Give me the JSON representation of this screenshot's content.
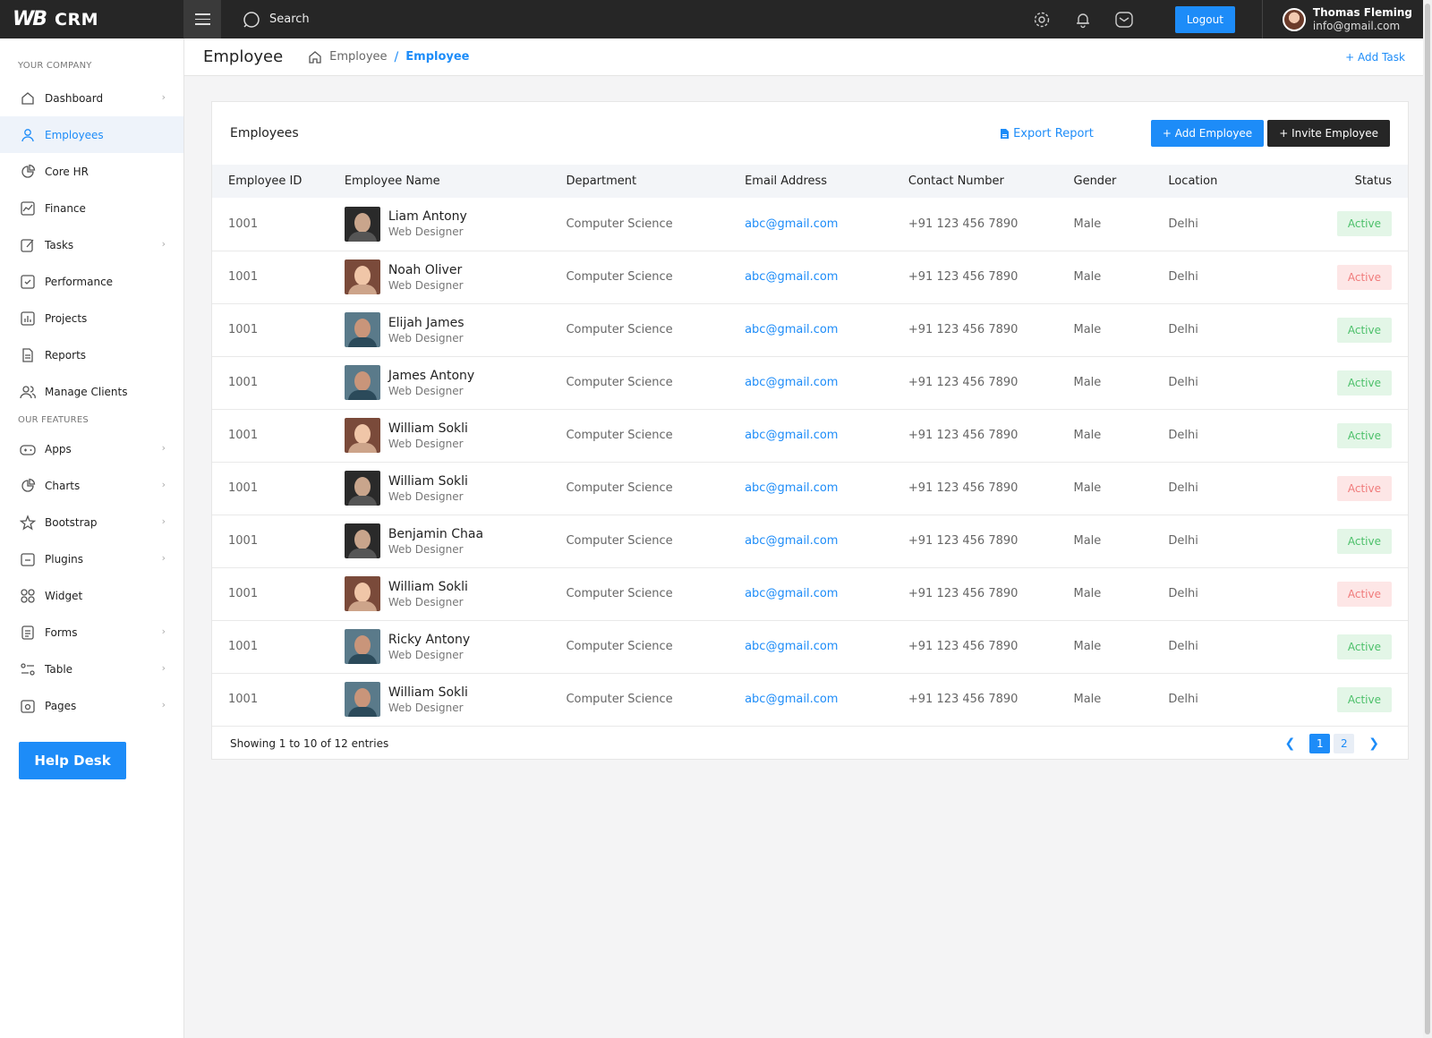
{
  "brand": {
    "logo": "WB",
    "name": "CRM"
  },
  "topbar": {
    "search_label": "Search",
    "logout_label": "Logout",
    "user_name": "Thomas Fleming",
    "user_email": "info@gmail.com"
  },
  "sidebar": {
    "section_company": "YOUR COMPANY",
    "section_features": "OUR FEATURES",
    "company_items": [
      {
        "label": "Dashboard",
        "icon": "home-icon",
        "chevron": true
      },
      {
        "label": "Employees",
        "icon": "user-icon",
        "active": true
      },
      {
        "label": "Core HR",
        "icon": "pie-icon"
      },
      {
        "label": "Finance",
        "icon": "chart-line-icon"
      },
      {
        "label": "Tasks",
        "icon": "edit-icon",
        "chevron": true
      },
      {
        "label": "Performance",
        "icon": "check-square-icon"
      },
      {
        "label": "Projects",
        "icon": "bar-chart-icon"
      },
      {
        "label": "Reports",
        "icon": "document-icon"
      },
      {
        "label": "Manage Clients",
        "icon": "users-icon"
      }
    ],
    "feature_items": [
      {
        "label": "Apps",
        "icon": "gamepad-icon",
        "chevron": true
      },
      {
        "label": "Charts",
        "icon": "pie-icon",
        "chevron": true
      },
      {
        "label": "Bootstrap",
        "icon": "star-icon",
        "chevron": true
      },
      {
        "label": "Plugins",
        "icon": "plugin-icon",
        "chevron": true
      },
      {
        "label": "Widget",
        "icon": "grid-icon"
      },
      {
        "label": "Forms",
        "icon": "form-icon",
        "chevron": true
      },
      {
        "label": "Table",
        "icon": "table-icon",
        "chevron": true
      },
      {
        "label": "Pages",
        "icon": "pages-icon",
        "chevron": true
      }
    ],
    "help_label": "Help Desk"
  },
  "page": {
    "title": "Employee",
    "crumb_1": "Employee",
    "crumb_sep": "/",
    "crumb_2": "Employee",
    "add_task": "+ Add Task"
  },
  "card": {
    "title": "Employees",
    "export_label": "Export Report",
    "add_label": "+ Add Employee",
    "invite_label": "+ Invite Employee",
    "columns": [
      "Employee ID",
      "Employee Name",
      "Department",
      "Email Address",
      "Contact Number",
      "Gender",
      "Location",
      "Status"
    ],
    "rows": [
      {
        "id": "1001",
        "name": "Liam Antony",
        "role": "Web Designer",
        "dept": "Computer Science",
        "email": "abc@gmail.com",
        "phone": "+91 123 456 7890",
        "gender": "Male",
        "location": "Delhi",
        "status": "Active",
        "status_kind": "on",
        "photo": "dark"
      },
      {
        "id": "1001",
        "name": "Noah Oliver",
        "role": "Web Designer",
        "dept": "Computer Science",
        "email": "abc@gmail.com",
        "phone": "+91 123 456 7890",
        "gender": "Male",
        "location": "Delhi",
        "status": "Active",
        "status_kind": "off",
        "photo": "woman"
      },
      {
        "id": "1001",
        "name": "Elijah James",
        "role": "Web Designer",
        "dept": "Computer Science",
        "email": "abc@gmail.com",
        "phone": "+91 123 456 7890",
        "gender": "Male",
        "location": "Delhi",
        "status": "Active",
        "status_kind": "on",
        "photo": "glasses"
      },
      {
        "id": "1001",
        "name": "James Antony",
        "role": "Web Designer",
        "dept": "Computer Science",
        "email": "abc@gmail.com",
        "phone": "+91 123 456 7890",
        "gender": "Male",
        "location": "Delhi",
        "status": "Active",
        "status_kind": "on",
        "photo": "glasses"
      },
      {
        "id": "1001",
        "name": "William Sokli",
        "role": "Web Designer",
        "dept": "Computer Science",
        "email": "abc@gmail.com",
        "phone": "+91 123 456 7890",
        "gender": "Male",
        "location": "Delhi",
        "status": "Active",
        "status_kind": "on",
        "photo": "woman"
      },
      {
        "id": "1001",
        "name": "William Sokli",
        "role": "Web Designer",
        "dept": "Computer Science",
        "email": "abc@gmail.com",
        "phone": "+91 123 456 7890",
        "gender": "Male",
        "location": "Delhi",
        "status": "Active",
        "status_kind": "off",
        "photo": "dark"
      },
      {
        "id": "1001",
        "name": "Benjamin Chaa",
        "role": "Web Designer",
        "dept": "Computer Science",
        "email": "abc@gmail.com",
        "phone": "+91 123 456 7890",
        "gender": "Male",
        "location": "Delhi",
        "status": "Active",
        "status_kind": "on",
        "photo": "dark"
      },
      {
        "id": "1001",
        "name": "William Sokli",
        "role": "Web Designer",
        "dept": "Computer Science",
        "email": "abc@gmail.com",
        "phone": "+91 123 456 7890",
        "gender": "Male",
        "location": "Delhi",
        "status": "Active",
        "status_kind": "off",
        "photo": "woman"
      },
      {
        "id": "1001",
        "name": "Ricky Antony",
        "role": "Web Designer",
        "dept": "Computer Science",
        "email": "abc@gmail.com",
        "phone": "+91 123 456 7890",
        "gender": "Male",
        "location": "Delhi",
        "status": "Active",
        "status_kind": "on",
        "photo": "glasses"
      },
      {
        "id": "1001",
        "name": "William Sokli",
        "role": "Web Designer",
        "dept": "Computer Science",
        "email": "abc@gmail.com",
        "phone": "+91 123 456 7890",
        "gender": "Male",
        "location": "Delhi",
        "status": "Active",
        "status_kind": "on",
        "photo": "glasses"
      }
    ],
    "footer_text": "Showing 1 to 10 of 12 entries",
    "pages": [
      "1",
      "2"
    ],
    "current_page": "1"
  },
  "colors": {
    "accent": "#1d8cf8",
    "topbar": "#262626",
    "active_green": "#4cc06a",
    "inactive_red": "#f07b7b"
  }
}
